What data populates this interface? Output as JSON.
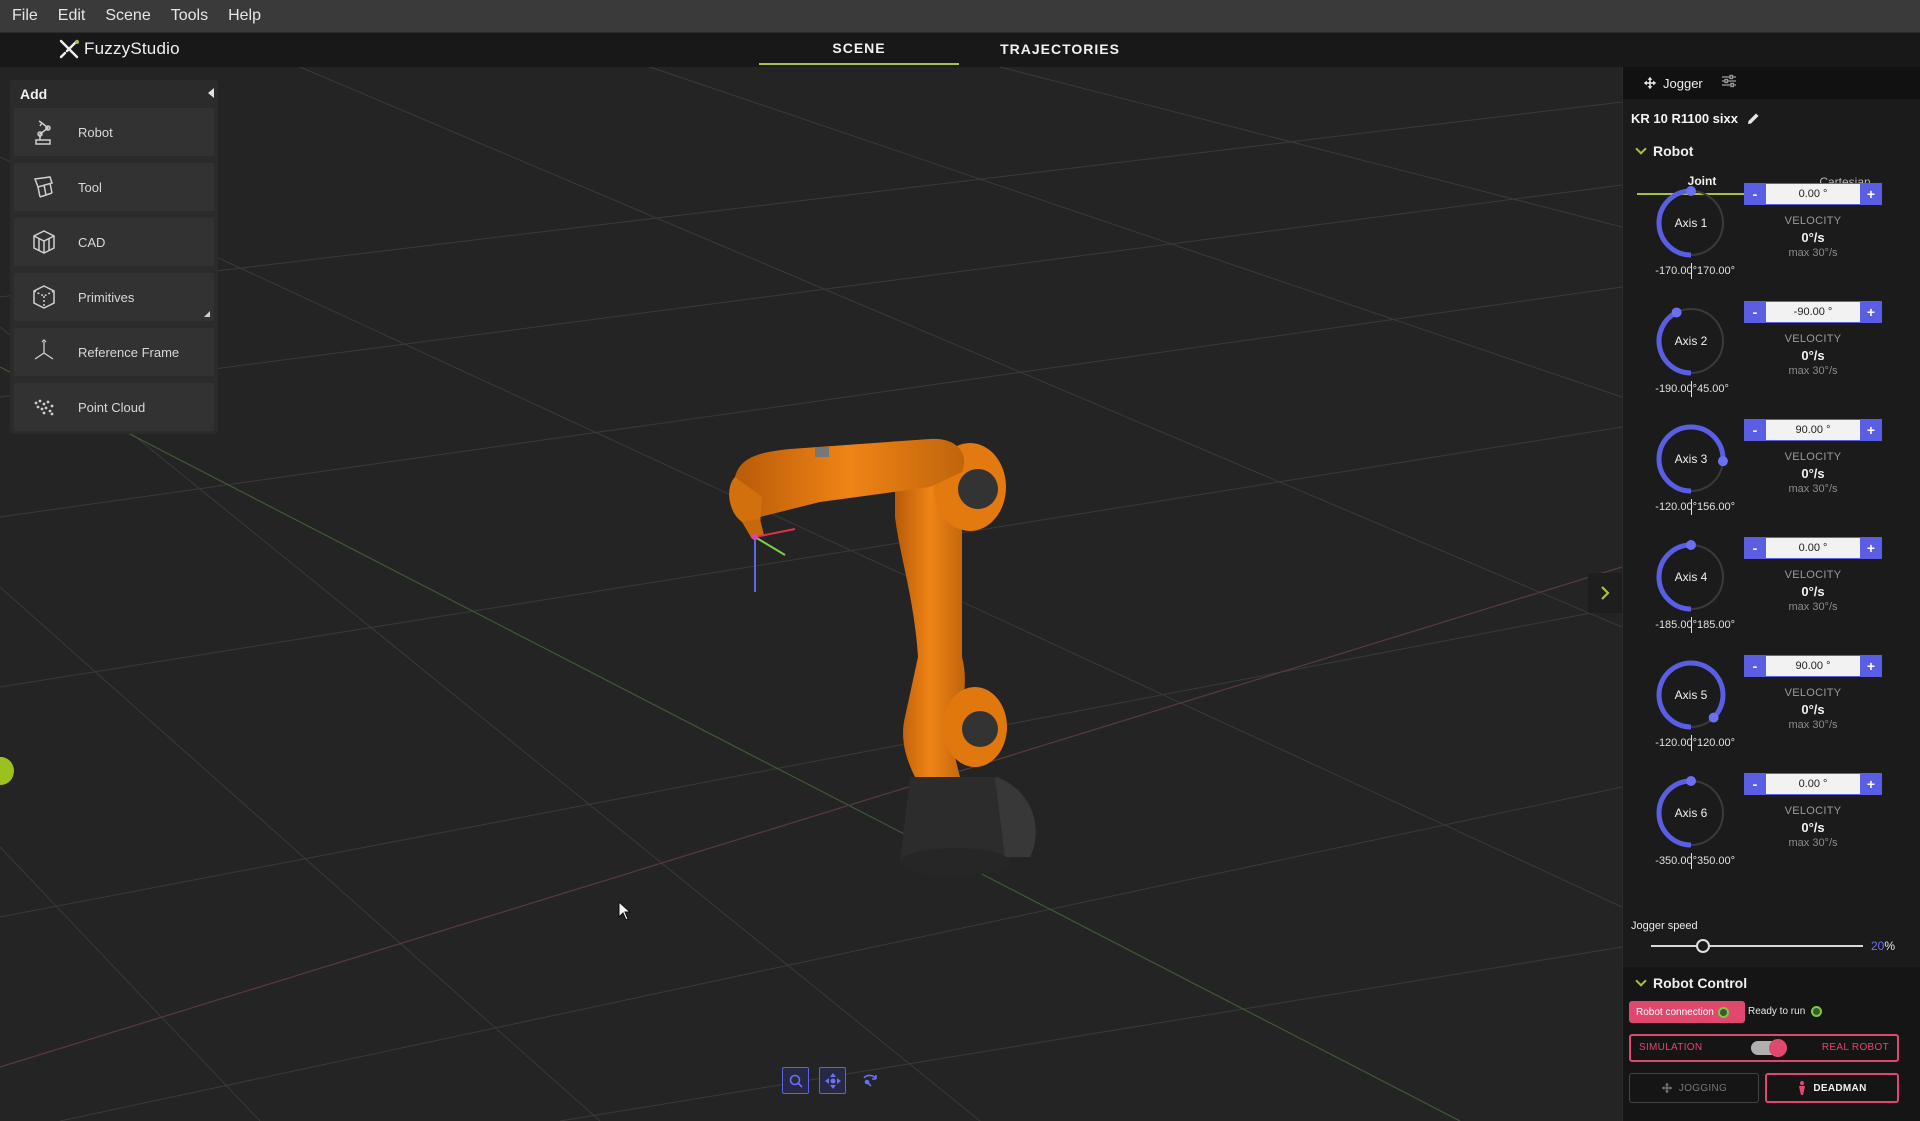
{
  "menu": [
    "File",
    "Edit",
    "Scene",
    "Tools",
    "Help"
  ],
  "app": {
    "logo_text": "FuzzyStudio"
  },
  "top_tabs": {
    "scene": "SCENE",
    "trajectories": "TRAJECTORIES",
    "active": "scene"
  },
  "add_panel": {
    "title": "Add",
    "items": [
      {
        "label": "Robot",
        "icon": "robot-arm-icon"
      },
      {
        "label": "Tool",
        "icon": "tool-icon"
      },
      {
        "label": "CAD",
        "icon": "cad-cube-icon"
      },
      {
        "label": "Primitives",
        "icon": "primitives-cube-icon"
      },
      {
        "label": "Reference Frame",
        "icon": "reference-frame-icon"
      },
      {
        "label": "Point Cloud",
        "icon": "point-cloud-icon"
      }
    ]
  },
  "right_panel": {
    "tab_jogger": "Jogger",
    "robot_name": "KR 10 R1100 sixx",
    "robot_section": "Robot",
    "joint_tab": "Joint",
    "cartesian_tab": "Cartesian",
    "velocity_label": "VELOCITY",
    "axes": [
      {
        "name": "Axis 1",
        "value": "0.00 °",
        "min": "-170.00°",
        "max": "170.00°",
        "min_deg": -170,
        "max_deg": 170,
        "cur_deg": 0,
        "velocity": "0°/s",
        "vmax": "max 30°/s"
      },
      {
        "name": "Axis 2",
        "value": "-90.00 °",
        "min": "-190.00°",
        "max": "45.00°",
        "min_deg": -190,
        "max_deg": 45,
        "cur_deg": -90,
        "velocity": "0°/s",
        "vmax": "max 30°/s"
      },
      {
        "name": "Axis 3",
        "value": "90.00 °",
        "min": "-120.00°",
        "max": "156.00°",
        "min_deg": -120,
        "max_deg": 156,
        "cur_deg": 90,
        "velocity": "0°/s",
        "vmax": "max 30°/s"
      },
      {
        "name": "Axis 4",
        "value": "0.00 °",
        "min": "-185.00°",
        "max": "185.00°",
        "min_deg": -185,
        "max_deg": 185,
        "cur_deg": 0,
        "velocity": "0°/s",
        "vmax": "max 30°/s"
      },
      {
        "name": "Axis 5",
        "value": "90.00 °",
        "min": "-120.00°",
        "max": "120.00°",
        "min_deg": -120,
        "max_deg": 120,
        "cur_deg": 90,
        "velocity": "0°/s",
        "vmax": "max 30°/s"
      },
      {
        "name": "Axis 6",
        "value": "0.00 °",
        "min": "-350.00°",
        "max": "350.00°",
        "min_deg": -350,
        "max_deg": 350,
        "cur_deg": 0,
        "velocity": "0°/s",
        "vmax": "max 30°/s"
      }
    ],
    "jogger_speed_label": "Jogger speed",
    "jogger_speed_value": "20",
    "jogger_speed_unit": "%",
    "robot_control": {
      "title": "Robot Control",
      "connection": "Robot connection",
      "ready": "Ready to run",
      "simulation": "SIMULATION",
      "real_robot": "REAL ROBOT",
      "jogging": "JOGGING",
      "deadman": "DEADMAN"
    }
  },
  "colors": {
    "accent": "#a8c43a",
    "dial": "#5a5ee3",
    "danger": "#e0486e",
    "robot": "#e8780e"
  }
}
